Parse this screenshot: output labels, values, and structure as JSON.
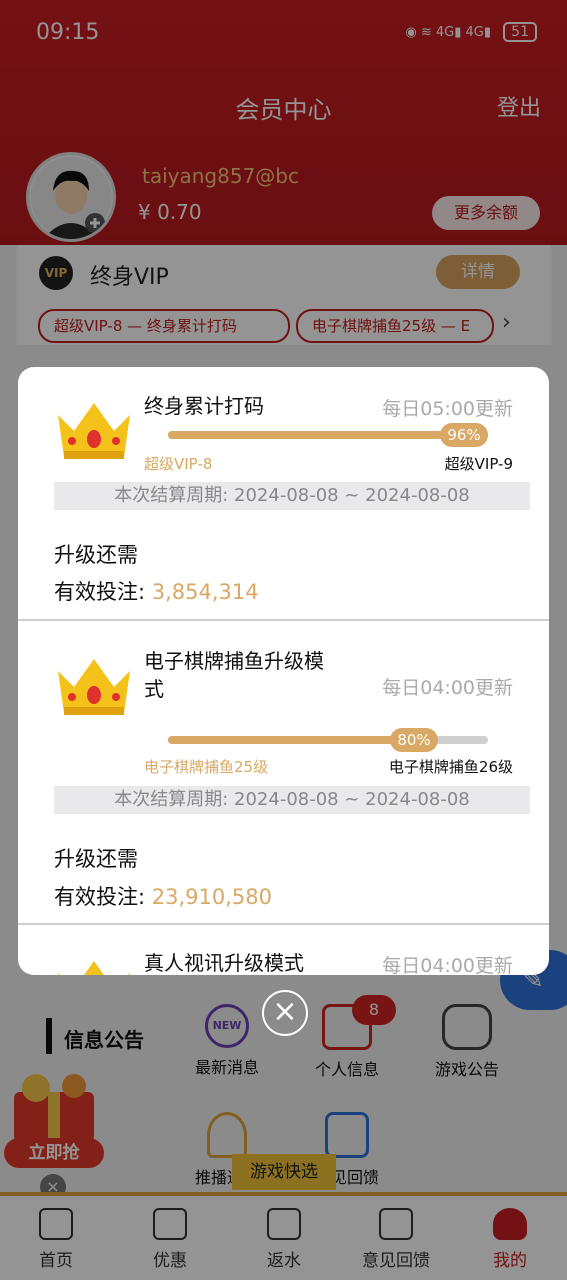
{
  "status": {
    "time": "09:15",
    "net1": "4G",
    "net2": "4G",
    "battery": "51"
  },
  "header": {
    "title": "会员中心",
    "logout": "登出"
  },
  "account": {
    "username": "taiyang857@bc",
    "balance": "¥ 0.70",
    "more_balance": "更多余额"
  },
  "vip": {
    "badge": "VIP",
    "label": "终身VIP",
    "detail": "详情",
    "chips": [
      "超级VIP-8 — 终身累计打码",
      "电子棋牌捕鱼25级 — E"
    ]
  },
  "modal": {
    "sections": [
      {
        "title": "终身累计打码",
        "update": "每日05:00更新",
        "progress": 0.96,
        "pct_label": "96%",
        "from": "超级VIP-8",
        "to": "超级VIP-9",
        "period": "本次结算周期: 2024-08-08 ~ 2024-08-08",
        "need": "升级还需",
        "bet_label": "有效投注:",
        "bet_value": "3,854,314"
      },
      {
        "title": "电子棋牌捕鱼升级模式",
        "update": "每日04:00更新",
        "progress": 0.8,
        "pct_label": "80%",
        "from": "电子棋牌捕鱼25级",
        "to": "电子棋牌捕鱼26级",
        "period": "本次结算周期: 2024-08-08 ~ 2024-08-08",
        "need": "升级还需",
        "bet_label": "有效投注:",
        "bet_value": "23,910,580"
      },
      {
        "title": "真人视讯升级模式",
        "update": "每日04:00更新"
      }
    ]
  },
  "notice": {
    "title": "信息公告",
    "items": [
      "最新消息",
      "个人信息",
      "游戏公告",
      "推播通知",
      "意见回馈"
    ],
    "new_badge": "NEW",
    "unread": "8"
  },
  "promo": {
    "grab": "立即抢",
    "close": "×"
  },
  "quick": "游戏快选",
  "tabs": [
    "首页",
    "优惠",
    "返水",
    "意见回馈",
    "我的"
  ],
  "colors": {
    "brand_red": "#c81e24",
    "gold": "#d8a864"
  }
}
